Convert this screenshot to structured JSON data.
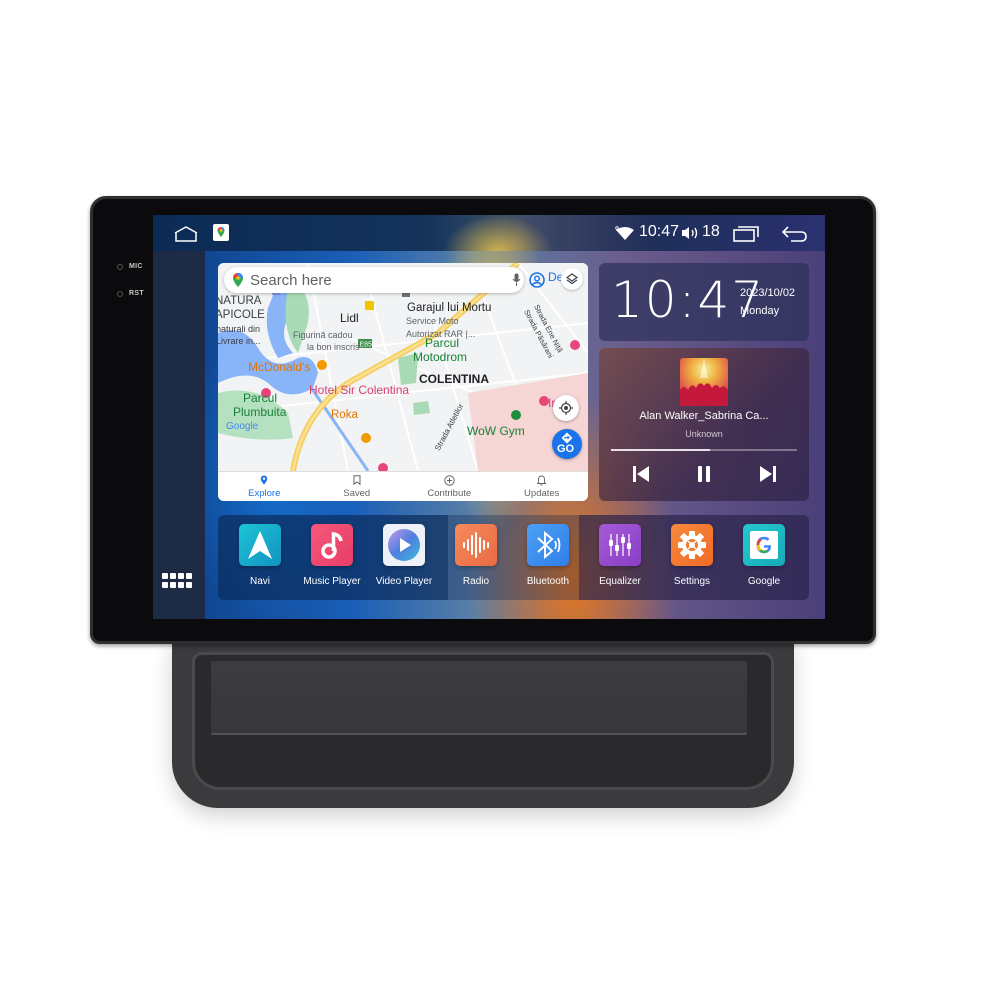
{
  "device": {
    "buttons": [
      {
        "label": "MIC"
      },
      {
        "label": "RST"
      }
    ]
  },
  "statusbar": {
    "time": "10:47",
    "volume": "18",
    "icons": [
      "home-icon",
      "google-maps-icon",
      "wifi-icon",
      "volume-icon",
      "recent-apps-icon",
      "back-icon"
    ]
  },
  "map": {
    "search_placeholder": "Search here",
    "partial_chip": "De",
    "labels": {
      "natura": "NATURA",
      "apicole": "APICOLE",
      "naturali": "naturali din",
      "livrare": "Livrare in...",
      "lidl": "Lidl",
      "figurina": "Figurină cadou",
      "bon": "la bon inscris",
      "garajul": "Garajul lui Mortu",
      "service": "Service Moto",
      "autorizat": "Autorizat RAR |...",
      "ene": "Strada Ene Niță",
      "pasarani": "Strada Păsărani",
      "e85": "E85",
      "parcul_moto": "Parcul",
      "motodrom": "Motodrom",
      "mcdonalds": "McDonald's",
      "colentina": "COLENTINA",
      "hotel": "Hotel Sir Colentina",
      "parcul_plumb": "Parcul",
      "plumbuita": "Plumbuita",
      "roka": "Roka",
      "atletilor": "Strada Atletilor",
      "wow": "WoW Gym",
      "google": "Google",
      "inst": "Ir",
      "go": "GO"
    },
    "nav": [
      {
        "label": "Explore",
        "icon": "pin-icon",
        "active": true
      },
      {
        "label": "Saved",
        "icon": "bookmark-icon",
        "active": false
      },
      {
        "label": "Contribute",
        "icon": "plus-circle-icon",
        "active": false
      },
      {
        "label": "Updates",
        "icon": "bell-icon",
        "active": false
      }
    ]
  },
  "clock": {
    "time": "10:47",
    "date": "2023/10/02",
    "day": "Monday"
  },
  "music": {
    "title": "Alan Walker_Sabrina Ca...",
    "artist": "Unknown",
    "progress": 0.53
  },
  "dock": {
    "apps": [
      {
        "label": "Navi",
        "icon": "navigation-arrow-icon",
        "color": "#19b7c8"
      },
      {
        "label": "Music Player",
        "icon": "music-note-icon",
        "color": "#ef4f6e"
      },
      {
        "label": "Video Player",
        "icon": "play-icon",
        "color": "#eef2f8"
      },
      {
        "label": "Radio",
        "icon": "radio-waves-icon",
        "color": "#f07a52"
      },
      {
        "label": "Bluetooth",
        "icon": "bluetooth-icon",
        "color": "#3f8ff0"
      },
      {
        "label": "Equalizer",
        "icon": "equalizer-icon",
        "color": "#9b4fd1"
      },
      {
        "label": "Settings",
        "icon": "gear-icon",
        "color": "#f47a32"
      },
      {
        "label": "Google",
        "icon": "google-icon",
        "color": "#1fc0c6"
      }
    ]
  },
  "colors": {
    "accent_blue": "#1a73e8",
    "map_road_yellow": "#f6cf65",
    "map_water": "#8ab4f8",
    "map_park": "#a8dab5"
  }
}
